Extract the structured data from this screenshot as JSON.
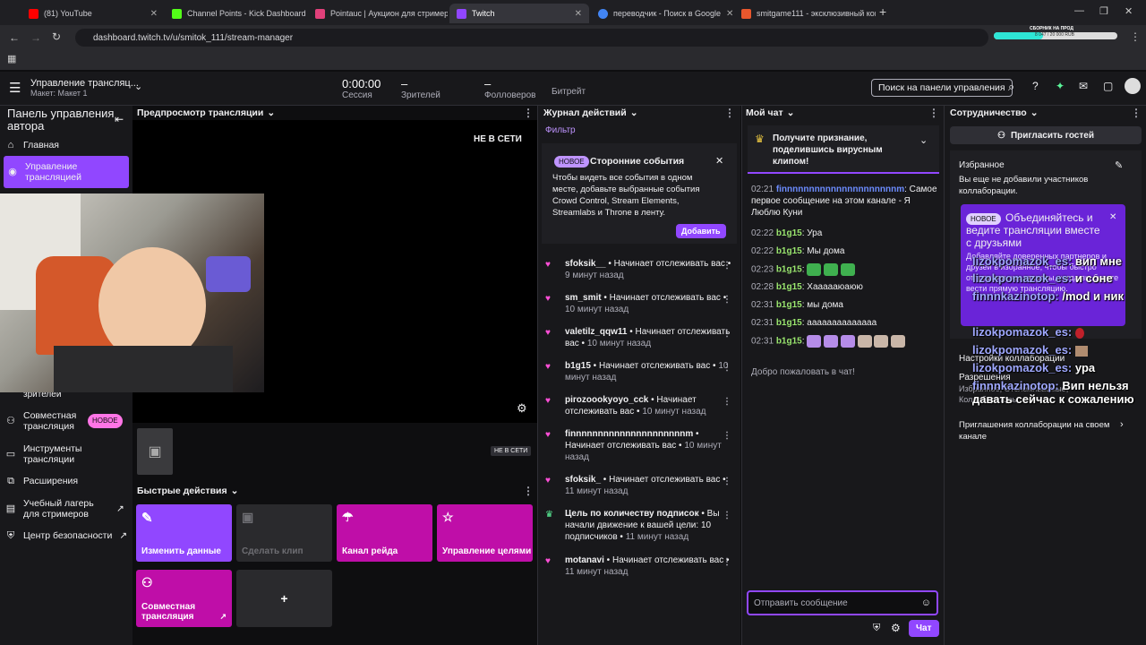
{
  "browser": {
    "tabs": [
      {
        "label": "(81) YouTube",
        "color": "#ff0000"
      },
      {
        "label": "Channel Points - Kick Dashboard",
        "color": "#53fc18"
      },
      {
        "label": "Pointauc | Аукцион для стримеров",
        "color": "#e0407a"
      },
      {
        "label": "Twitch",
        "color": "#9146ff"
      },
      {
        "label": "переводчик - Поиск в Google",
        "color": "#4285f4"
      },
      {
        "label": "smitgame111 - эксклюзивный контент",
        "color": "#e8572d"
      }
    ],
    "url": "dashboard.twitch.tv/u/smitok_111/stream-manager",
    "ext_text_top": "СБОРНИК НА ПРОД",
    "ext_text_bottom": "8 047 / 20 000 RUB"
  },
  "topnav": {
    "title": "Управление трансляц...",
    "subtitle": "Макет: Макет 1",
    "session_value": "0:00:00",
    "session_label": "Сессия",
    "viewers_value": "–",
    "viewers_label": "Зрителей",
    "followers_value": "–",
    "followers_label": "Фолловеров",
    "subs_label": "Битрейт",
    "search_label": "Поиск на панели управления"
  },
  "leftnav": {
    "title": "Панель управления автора",
    "items": {
      "home": "Главная",
      "stream_manager": "Управление трансляцией",
      "viewers": "зрителей",
      "collab": "Совместная трансляция",
      "collab_badge": "НОВОЕ",
      "tools": "Инструменты трансляции",
      "extensions": "Расширения",
      "bootcamp": "Учебный лагерь для стримеров",
      "safety": "Центр безопасности"
    }
  },
  "preview": {
    "title": "Предпросмотр трансляции",
    "offline": "НЕ В СЕТИ",
    "offline_small": "НЕ В СЕТИ"
  },
  "quick": {
    "title": "Быстрые действия",
    "items": [
      {
        "label": "Изменить данные",
        "color": "#9147ff"
      },
      {
        "label": "Сделать клип",
        "color": "#2a2a2d"
      },
      {
        "label": "Канал рейда",
        "color": "#bf0ea8"
      },
      {
        "label": "Управление целями",
        "color": "#bf0ea8"
      },
      {
        "label": "Совместная трансляция",
        "color": "#bf0ea8"
      }
    ],
    "add_label": "+"
  },
  "activity": {
    "title": "Журнал действий",
    "filter": "Фильтр",
    "promo_badge": "НОВОЕ",
    "promo_title": "Сторонние события",
    "promo_text": "Чтобы видеть все события в одном месте, добавьте выбранные события Crowd Control, Stream Elements, Streamlabs и Throne в ленту.",
    "promo_btn": "Добавить",
    "events": [
      {
        "user": "sfoksik__",
        "action": "Начинает отслеживать вас",
        "time": "9 минут назад"
      },
      {
        "user": "sm_smit",
        "action": "Начинает отслеживать вас",
        "time": "10 минут назад"
      },
      {
        "user": "valetilz_qqw11",
        "action": "Начинает отслеживать вас",
        "time": "10 минут назад"
      },
      {
        "user": "b1g15",
        "action": "Начинает отслеживать вас",
        "time": "10 минут назад"
      },
      {
        "user": "pirozoookyoyo_cck",
        "action": "Начинает отслеживать вас",
        "time": "10 минут назад"
      },
      {
        "user": "finnnnnnnnnnnnnnnnnnnnnm",
        "action": "Начинает отслеживать вас",
        "time": "10 минут назад"
      },
      {
        "user": "sfoksik_",
        "action": "Начинает отслеживать вас",
        "time": "11 минут назад"
      },
      {
        "user": "Цель по количеству подписок",
        "action": "Вы начали движение к вашей цели: 10 подписчиков",
        "time": "11 минут назад"
      },
      {
        "user": "motanavi",
        "action": "Начинает отслеживать вас",
        "time": "11 минут назад"
      }
    ]
  },
  "chat": {
    "title": "Мой чат",
    "pin_text": "Получите признание, поделившись вирусным клипом!",
    "messages": [
      {
        "time": "02:21",
        "user": "finnnnnnnnnnnnnnnnnnnnnm",
        "text": "Самое первое сообщение на этом канале - Я Люблю Куни"
      },
      {
        "time": "02:22",
        "user": "b1g15",
        "text": "Ура"
      },
      {
        "time": "02:22",
        "user": "b1g15",
        "text": "Мы дома"
      },
      {
        "time": "02:23",
        "user": "b1g15",
        "text": ""
      },
      {
        "time": "02:28",
        "user": "b1g15",
        "text": "Хаааааюаюю"
      },
      {
        "time": "02:31",
        "user": "b1g15",
        "text": "мы дома"
      },
      {
        "time": "02:31",
        "user": "b1g15",
        "text": "аааааааааааааа"
      },
      {
        "time": "02:31",
        "user": "b1g15",
        "text": ""
      }
    ],
    "welcome": "Добро пожаловать в чат!",
    "input_placeholder": "Отправить сообщение",
    "chat_btn": "Чат"
  },
  "collab": {
    "title": "Сотрудничество",
    "invite": "Пригласить гостей",
    "fav_title": "Избранное",
    "fav_text": "Вы еще не добавили участников коллаборации.",
    "promo_badge": "НОВОЕ",
    "promo_title": "Объединяйтесь и ведите трансляции вместе с друзьями",
    "promo_text": "Добавляйте доверенных партнеров и друзей в избранное, чтобы быстро отправлять им запросы, когда вы будете вести прямую трансляцию.",
    "settings_title": "Настройки коллаборации",
    "perm_title": "Разрешения",
    "perm_sub": "Избранное, Отслеживаемые, Коллабораторы",
    "invite_setting": "Приглашения коллаборации на своем канале"
  },
  "overlay": [
    {
      "user": "lizokpomazok_es:",
      "text": "вип мне"
    },
    {
      "user": "lizokpomazok_es:",
      "text": "и соне"
    },
    {
      "user": "finnnkazinotop:",
      "text": "/mod и ник"
    },
    {
      "user": "lizokpomazok_es:",
      "text": ""
    },
    {
      "user": "lizokpomazok_es:",
      "text": ""
    },
    {
      "user": "lizokpomazok_es:",
      "text": "ура"
    },
    {
      "user": "finnnkazinotop:",
      "text": "Вип нельзя давать сейчас к сожалению"
    }
  ]
}
